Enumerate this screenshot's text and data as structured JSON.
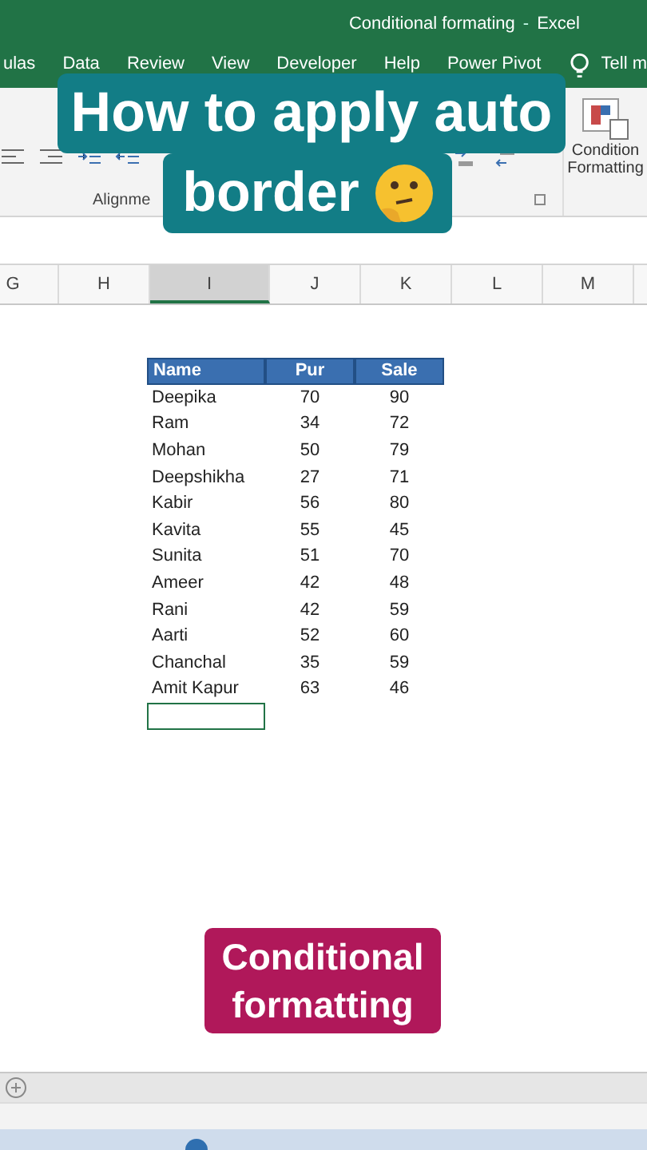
{
  "window": {
    "title": "Conditional formating",
    "separator": "-",
    "app": "Excel"
  },
  "ribbon_tabs": [
    {
      "label": "ulas"
    },
    {
      "label": "Data"
    },
    {
      "label": "Review"
    },
    {
      "label": "View"
    },
    {
      "label": "Developer"
    },
    {
      "label": "Help"
    },
    {
      "label": "Power Pivot"
    }
  ],
  "tell_me": "Tell m",
  "ribbon": {
    "group_label": "Alignme",
    "conditional_button": [
      "Condition",
      "Formatting"
    ]
  },
  "columns": [
    {
      "label": "G",
      "selected": false
    },
    {
      "label": "H",
      "selected": false
    },
    {
      "label": "I",
      "selected": true
    },
    {
      "label": "J",
      "selected": false
    },
    {
      "label": "K",
      "selected": false
    },
    {
      "label": "L",
      "selected": false
    },
    {
      "label": "M",
      "selected": false
    }
  ],
  "table": {
    "columns": [
      "Name",
      "Pur",
      "Sale"
    ],
    "rows": [
      [
        "Deepika",
        "70",
        "90"
      ],
      [
        "Ram",
        "34",
        "72"
      ],
      [
        "Mohan",
        "50",
        "79"
      ],
      [
        "Deepshikha",
        "27",
        "71"
      ],
      [
        "Kabir",
        "56",
        "80"
      ],
      [
        "Kavita",
        "55",
        "45"
      ],
      [
        "Sunita",
        "51",
        "70"
      ],
      [
        "Ameer",
        "42",
        "48"
      ],
      [
        "Rani",
        "42",
        "59"
      ],
      [
        "Aarti",
        "52",
        "60"
      ],
      [
        "Chanchal",
        "35",
        "59"
      ],
      [
        "Amit Kapur",
        "63",
        "46"
      ]
    ]
  },
  "caption_top": {
    "lines": [
      "How to apply auto",
      "border"
    ]
  },
  "caption_bottom": {
    "lines": [
      "Conditional",
      "formatting"
    ]
  }
}
